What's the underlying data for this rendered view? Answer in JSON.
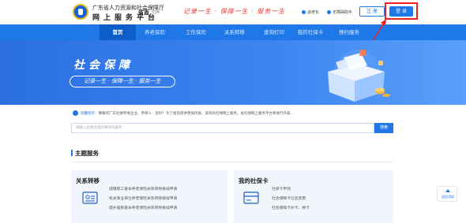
{
  "header": {
    "org_line1": "广东省人力资源和社会保障厅",
    "org_line2": "网上服务平台",
    "region": "省直",
    "region_switch": "切换",
    "slogan": "记录一生 · 保障一生 · 服务一生",
    "elder_mode": "适老化",
    "accessibility": "无障碍助手",
    "register": "注 册",
    "login": "登 录"
  },
  "nav": {
    "items": [
      {
        "label": "首页",
        "active": true
      },
      {
        "label": "养老保险",
        "active": false
      },
      {
        "label": "工伤保险",
        "active": false
      },
      {
        "label": "关系转移",
        "active": false
      },
      {
        "label": "查询打印",
        "active": false
      },
      {
        "label": "我的社保卡",
        "active": false
      },
      {
        "label": "预约服务",
        "active": false
      }
    ]
  },
  "banner": {
    "title": "社会保障",
    "subtitle": "记录一生 · 保障一生 · 服务一生"
  },
  "notice": {
    "label": "温馨提示：",
    "text": "尊敬的广东社保参保企业、参保人：您好！为了给您提供更加优质、高效的社保网上服务，省社保网上服务平台将进行升级..."
  },
  "search": {
    "placeholder": "请输入您要办理的事项或服务",
    "button": "搜索"
  },
  "section": {
    "title": "主题服务"
  },
  "cards": [
    {
      "title": "关系转移",
      "icon": "id-card-icon",
      "links": [
        "城镇职工基本养老保险关系转移接续申请",
        "机关事业单位养老保险关系转移接续申请",
        "城乡居民基本养老保险关系转移接续申请"
      ]
    },
    {
      "title": "我的社保卡",
      "icon": "card-icon",
      "links": [
        "社保卡申领",
        "社会保障卡信息变更",
        "社会保障卡补卡、换卡"
      ]
    }
  ],
  "side": {
    "back_top": "返回顶部"
  },
  "colors": {
    "primary": "#1e78e8",
    "nav_active": "#0d5ec9",
    "highlight": "#e22222"
  }
}
